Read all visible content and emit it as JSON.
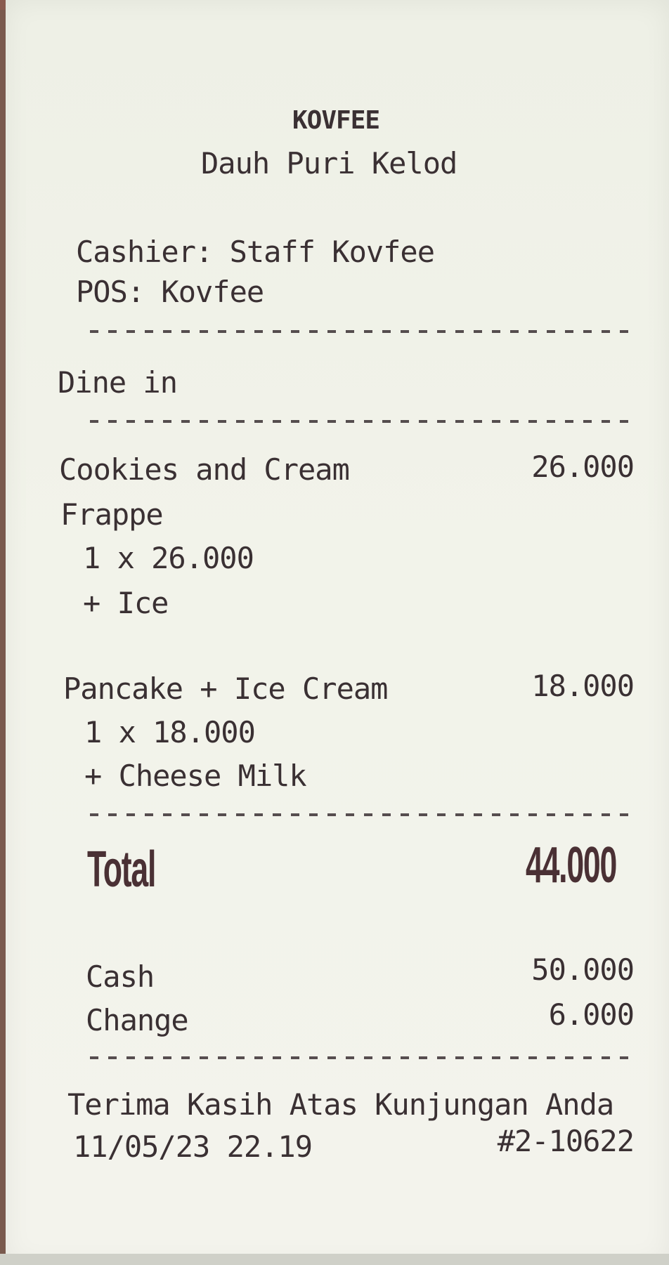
{
  "header": {
    "store_name": "KOVFEE",
    "location": "Dauh Puri Kelod",
    "cashier": "Cashier: Staff Kovfee",
    "pos": "POS:  Kovfee"
  },
  "order_type": "Dine in",
  "items": [
    {
      "name_line1": "Cookies and Cream",
      "name_line2": "Frappe",
      "price": "26.000",
      "qty_line": "1 x  26.000",
      "modifier": "+ Ice"
    },
    {
      "name_line1": "Pancake + Ice Cream",
      "price": "18.000",
      "qty_line": "1 x  18.000",
      "modifier": "+ Cheese Milk"
    }
  ],
  "totals": {
    "total_label": "Total",
    "total_value": "44.000",
    "cash_label": "Cash",
    "cash_value": "50.000",
    "change_label": "Change",
    "change_value": "6.000"
  },
  "footer": {
    "thanks": "Terima Kasih Atas Kunjungan Anda",
    "datetime": "11/05/23 22.19",
    "receipt_no": "#2-10622"
  },
  "colors": {
    "paper": "#f2f3ea",
    "ink": "#3a3033",
    "background": "#7a5a4e"
  }
}
